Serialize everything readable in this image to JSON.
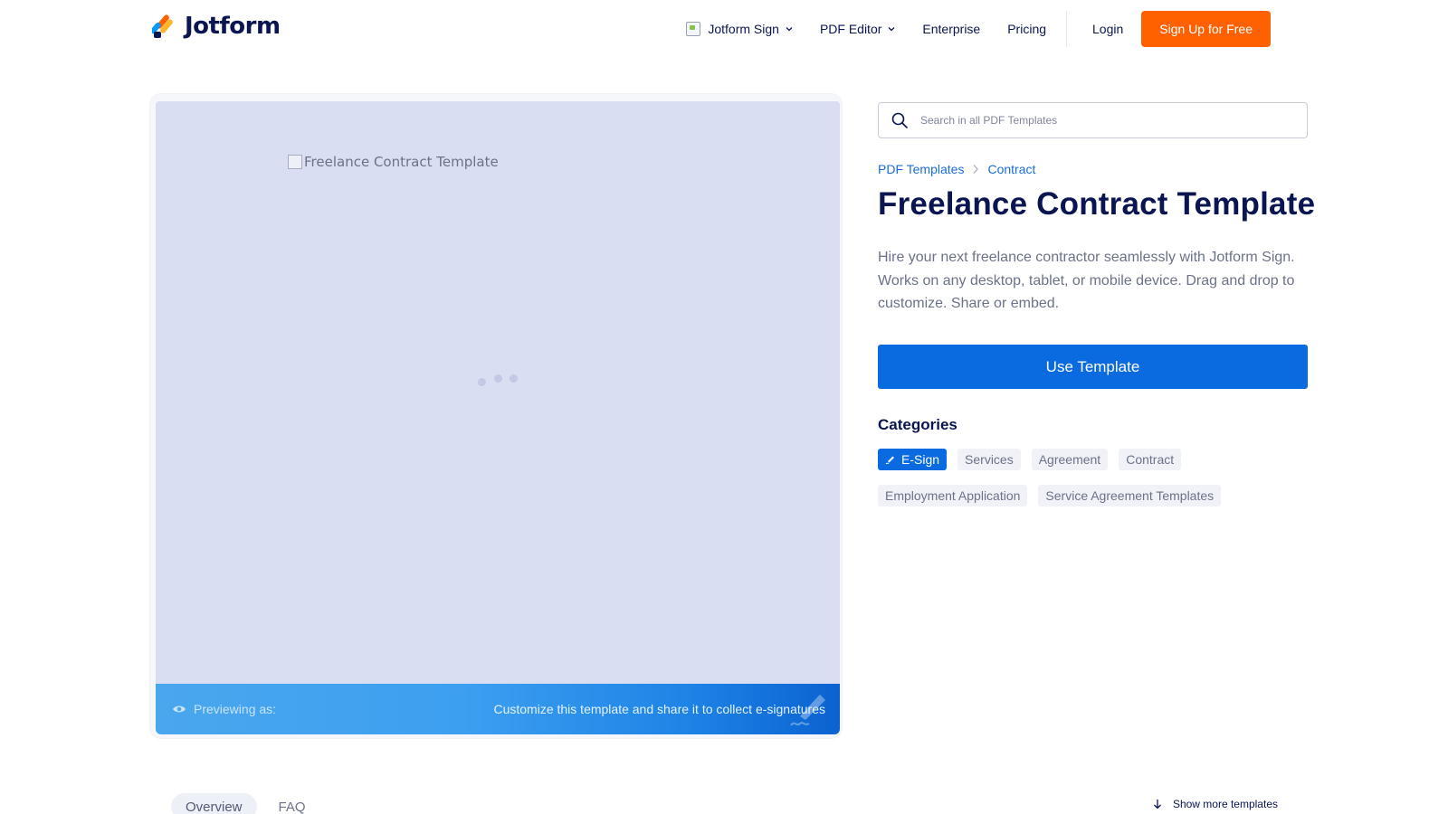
{
  "header": {
    "logo_text": "Jotform",
    "nav": {
      "sign_label": "Jotform Sign",
      "pdf_editor_label": "PDF Editor",
      "enterprise_label": "Enterprise",
      "pricing_label": "Pricing"
    },
    "login_label": "Login",
    "signup_label": "Sign Up for Free"
  },
  "preview": {
    "image_alt": "Freelance Contract Template",
    "previewing_label": "Previewing as:",
    "cta_text": "Customize this template and share it to collect e-signatures"
  },
  "search": {
    "placeholder": "Search in all PDF Templates"
  },
  "breadcrumb": {
    "items": [
      "PDF Templates",
      "Contract"
    ]
  },
  "template": {
    "title": "Freelance Contract Template",
    "description": "Hire your next freelance contractor seamlessly with Jotform Sign. Works on any desktop, tablet, or mobile device. Drag and drop to customize. Share or embed.",
    "use_button": "Use Template"
  },
  "categories": {
    "title": "Categories",
    "tags": [
      "E-Sign",
      "Services",
      "Agreement",
      "Contract",
      "Employment Application",
      "Service Agreement Templates"
    ]
  },
  "tabs": {
    "items": [
      "Overview",
      "FAQ"
    ],
    "active": "Overview"
  },
  "show_more_label": "Show more templates",
  "colors": {
    "brand_navy": "#0a1551",
    "signup_orange": "#ff6100",
    "primary_blue": "#0a6be0",
    "link_blue": "#1a6ed8",
    "preview_bg": "#dadef3"
  }
}
